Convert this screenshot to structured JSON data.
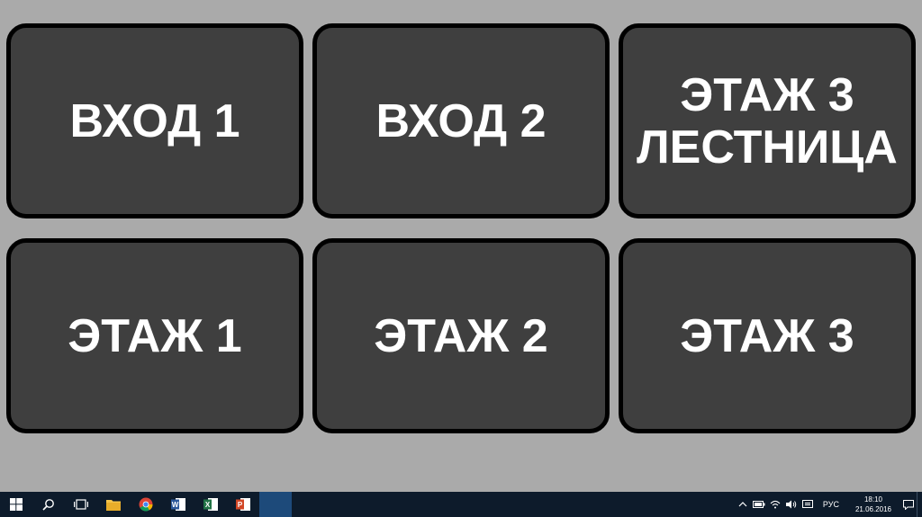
{
  "tiles": [
    {
      "label": "ВХОД 1"
    },
    {
      "label": "ВХОД 2"
    },
    {
      "label": "ЭТАЖ 3\nЛЕСТНИЦА"
    },
    {
      "label": "ЭТАЖ 1"
    },
    {
      "label": "ЭТАЖ 2"
    },
    {
      "label": "ЭТАЖ 3"
    }
  ],
  "taskbar": {
    "apps": [
      "start-icon",
      "search-icon",
      "task-view-icon",
      "file-explorer-icon",
      "chrome-icon",
      "word-icon",
      "excel-icon",
      "powerpoint-icon"
    ],
    "language": "РУС",
    "time": "18:10",
    "date": "21.06.2016"
  },
  "colors": {
    "background": "#aaaaaa",
    "tile": "#3f3f3f",
    "tile_border": "#000000",
    "tile_text": "#ffffff",
    "taskbar": "#0d1b2b"
  }
}
